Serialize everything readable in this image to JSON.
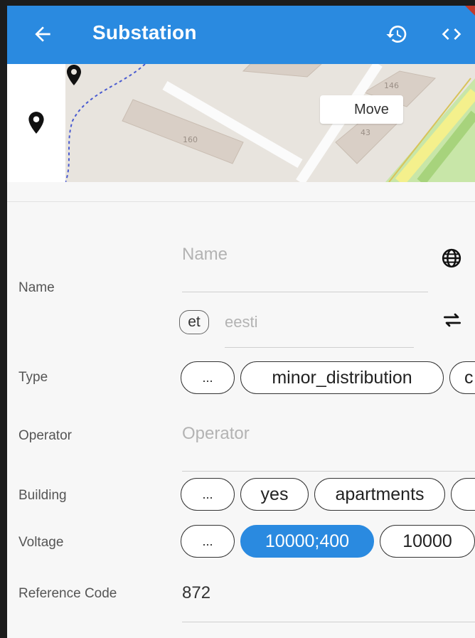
{
  "appbar": {
    "title": "Substation",
    "icons": [
      "arrow-back-icon",
      "history-icon",
      "code-icon"
    ],
    "color": "#2a8ae0"
  },
  "map": {
    "move_label": "Move",
    "labels": [
      "146",
      "43",
      "160"
    ]
  },
  "form": {
    "name": {
      "label": "Name",
      "placeholder": "Name",
      "lang_code": "et",
      "lang_placeholder": "eesti"
    },
    "type": {
      "label": "Type",
      "options": [
        "...",
        "minor_distribution",
        "c"
      ]
    },
    "operator": {
      "label": "Operator",
      "placeholder": "Operator"
    },
    "building": {
      "label": "Building",
      "options": [
        "...",
        "yes",
        "apartments"
      ]
    },
    "voltage": {
      "label": "Voltage",
      "options": [
        "...",
        "10000;400",
        "10000"
      ],
      "selected": "10000;400"
    },
    "reference_code": {
      "label": "Reference Code",
      "value": "872"
    }
  }
}
